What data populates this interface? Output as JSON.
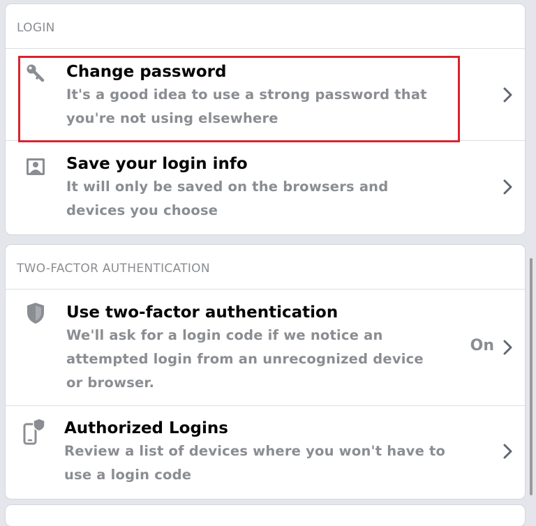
{
  "login": {
    "header": "LOGIN",
    "items": [
      {
        "title": "Change password",
        "description": "It's a good idea to use a strong password that you're not using elsewhere",
        "icon": "key-icon"
      },
      {
        "title": "Save your login info",
        "description": "It will only be saved on the browsers and devices you choose",
        "icon": "contact-card-icon"
      }
    ]
  },
  "two_factor": {
    "header": "TWO-FACTOR AUTHENTICATION",
    "items": [
      {
        "title": "Use two-factor authentication",
        "description": "We'll ask for a login code if we notice an attempted login from an unrecognized device or browser.",
        "status": "On",
        "icon": "shield-icon"
      },
      {
        "title": "Authorized Logins",
        "description": "Review a list of devices where you won't have to use a login code",
        "icon": "phone-shield-icon"
      }
    ]
  },
  "colors": {
    "highlight": "#d9232e",
    "primary_text": "#050505",
    "secondary_text": "#8a8d91",
    "background": "#e4e6eb"
  }
}
